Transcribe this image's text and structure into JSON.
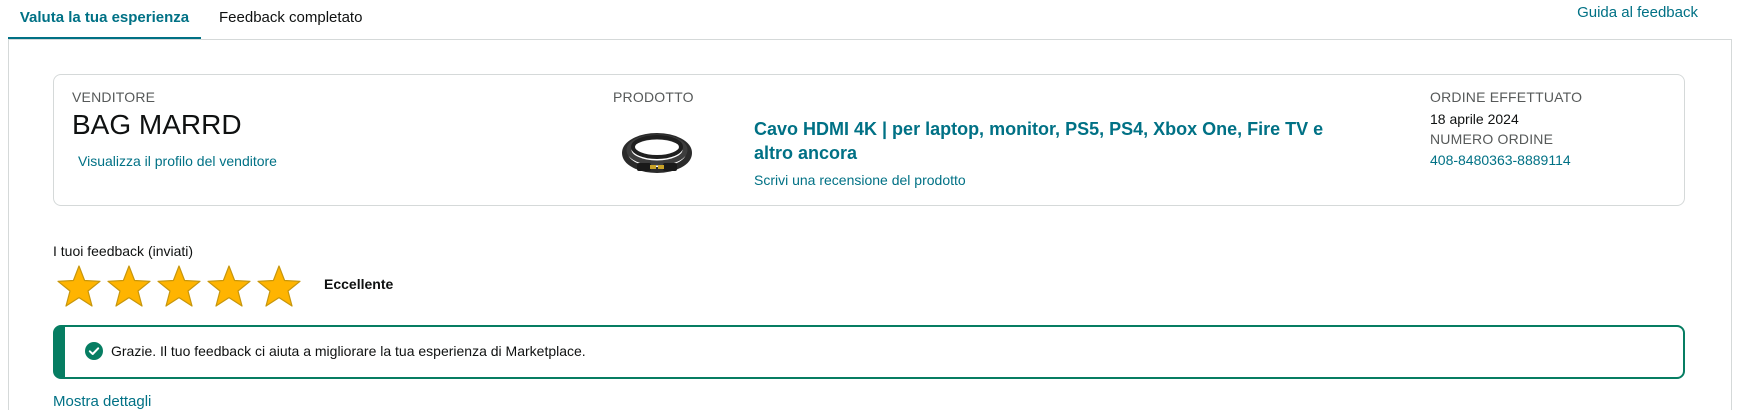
{
  "tabs": {
    "active": "Valuta la tua esperienza",
    "second": "Feedback completato",
    "guide": "Guida al feedback"
  },
  "seller": {
    "label": "VENDITORE",
    "name": "BAG MARRD",
    "profile_link": "Visualizza il profilo del venditore"
  },
  "product": {
    "label": "PRODOTTO",
    "title": "Cavo HDMI 4K | per laptop, monitor, PS5, PS4, Xbox One, Fire TV e altro ancora",
    "review_link": "Scrivi una recensione del prodotto",
    "image_icon": "hdmi-cable-image"
  },
  "order": {
    "placed_label": "ORDINE EFFETTUATO",
    "date": "18 aprile 2024",
    "number_label": "NUMERO ORDINE",
    "number": "408-8480363-8889114"
  },
  "feedback": {
    "label": "I tuoi feedback (inviati)",
    "rating": 5,
    "rating_text": "Eccellente",
    "star_color": "#ffb400"
  },
  "alert": {
    "text": "Grazie. Il tuo feedback ci aiuta a migliorare la tua esperienza di Marketplace.",
    "color": "#067d62",
    "icon": "check-circle-icon"
  },
  "details_link": "Mostra dettagli",
  "colors": {
    "link": "#007185",
    "border": "#d5d9d9"
  }
}
